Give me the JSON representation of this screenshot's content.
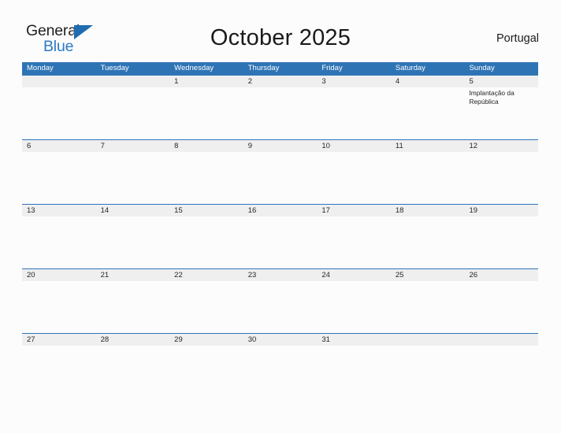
{
  "brand": {
    "name_part1": "General",
    "name_part2": "Blue",
    "triangle_icon": "triangle-icon",
    "color_dark": "#231f20",
    "color_blue": "#2a7ac4"
  },
  "header": {
    "title": "October 2025",
    "country": "Portugal"
  },
  "theme": {
    "header_blue": "#2e74b5",
    "row_band_gray": "#efefef",
    "page_background": "#fcfcfd",
    "text_color": "#1a1a1a"
  },
  "calendar": {
    "month": "October",
    "year": "2025",
    "first_day_of_week": "Monday",
    "weekday_headers": [
      "Monday",
      "Tuesday",
      "Wednesday",
      "Thursday",
      "Friday",
      "Saturday",
      "Sunday"
    ],
    "weeks": [
      {
        "days": [
          {
            "num": "",
            "event": ""
          },
          {
            "num": "",
            "event": ""
          },
          {
            "num": "1",
            "event": ""
          },
          {
            "num": "2",
            "event": ""
          },
          {
            "num": "3",
            "event": ""
          },
          {
            "num": "4",
            "event": ""
          },
          {
            "num": "5",
            "event": "Implantação da República"
          }
        ]
      },
      {
        "days": [
          {
            "num": "6",
            "event": ""
          },
          {
            "num": "7",
            "event": ""
          },
          {
            "num": "8",
            "event": ""
          },
          {
            "num": "9",
            "event": ""
          },
          {
            "num": "10",
            "event": ""
          },
          {
            "num": "11",
            "event": ""
          },
          {
            "num": "12",
            "event": ""
          }
        ]
      },
      {
        "days": [
          {
            "num": "13",
            "event": ""
          },
          {
            "num": "14",
            "event": ""
          },
          {
            "num": "15",
            "event": ""
          },
          {
            "num": "16",
            "event": ""
          },
          {
            "num": "17",
            "event": ""
          },
          {
            "num": "18",
            "event": ""
          },
          {
            "num": "19",
            "event": ""
          }
        ]
      },
      {
        "days": [
          {
            "num": "20",
            "event": ""
          },
          {
            "num": "21",
            "event": ""
          },
          {
            "num": "22",
            "event": ""
          },
          {
            "num": "23",
            "event": ""
          },
          {
            "num": "24",
            "event": ""
          },
          {
            "num": "25",
            "event": ""
          },
          {
            "num": "26",
            "event": ""
          }
        ]
      },
      {
        "days": [
          {
            "num": "27",
            "event": ""
          },
          {
            "num": "28",
            "event": ""
          },
          {
            "num": "29",
            "event": ""
          },
          {
            "num": "30",
            "event": ""
          },
          {
            "num": "31",
            "event": ""
          },
          {
            "num": "",
            "event": ""
          },
          {
            "num": "",
            "event": ""
          }
        ]
      }
    ]
  }
}
